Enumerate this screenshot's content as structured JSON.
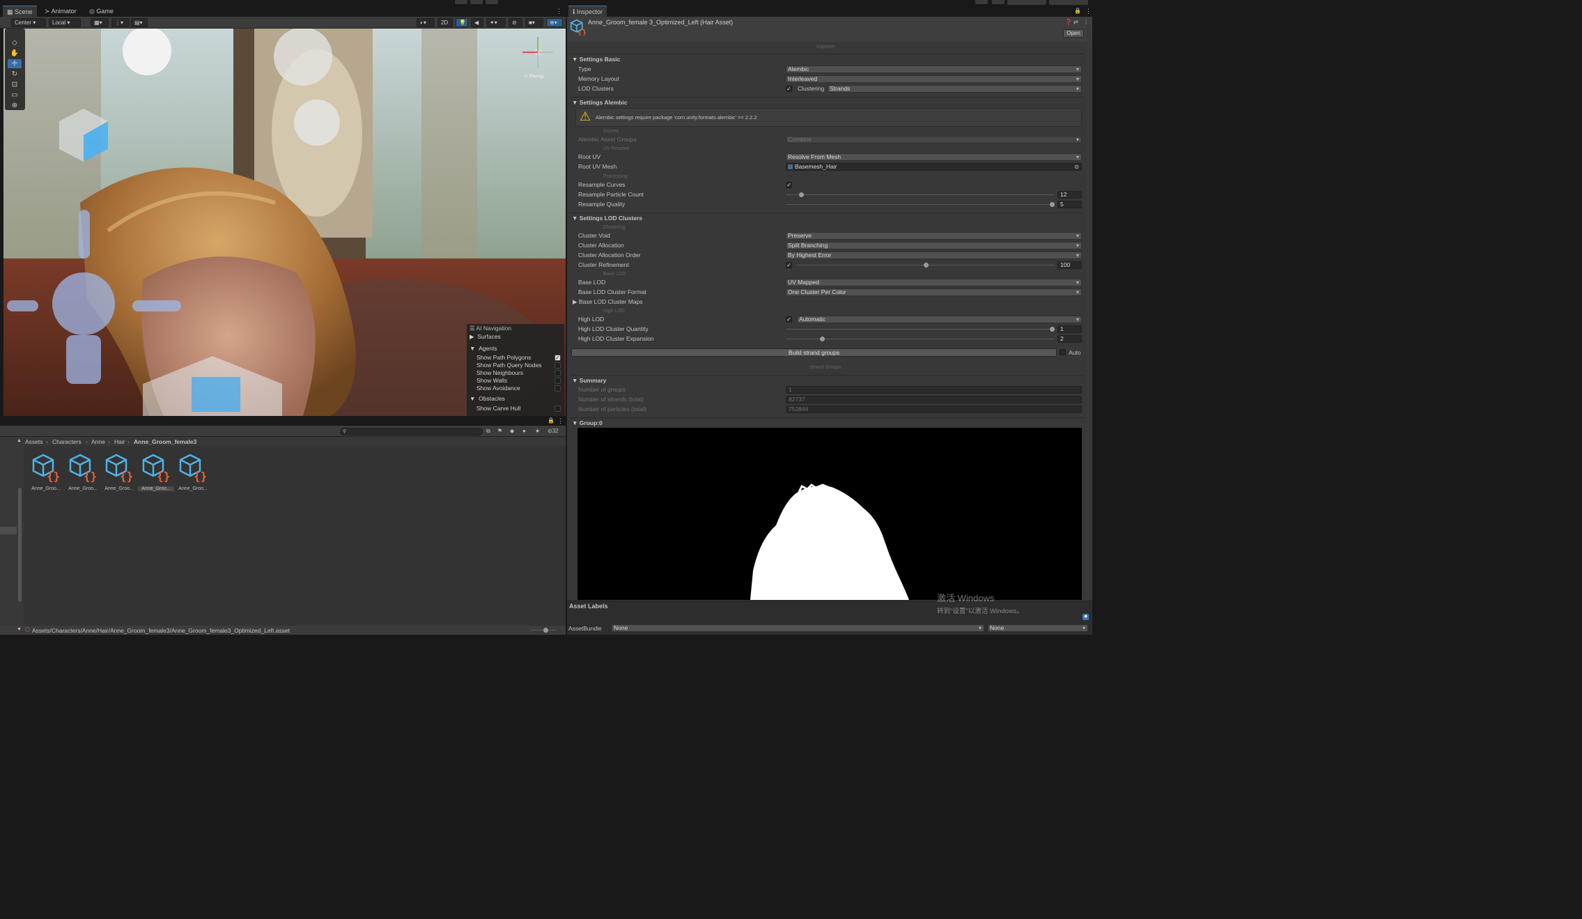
{
  "scene_tabs": {
    "scene": "Scene",
    "animator": "Animator",
    "game": "Game"
  },
  "scene_toolbar": {
    "pivot": "Center",
    "space": "Local",
    "mode_2d": "2D"
  },
  "viewport": {
    "persp_label": "< Persp"
  },
  "ai_navigation": {
    "title": "AI Navigation",
    "surfaces": "Surfaces",
    "agents": "Agents",
    "items": [
      {
        "label": "Show Path Polygons",
        "checked": true
      },
      {
        "label": "Show Path Query Nodes",
        "checked": false
      },
      {
        "label": "Show Neighbours",
        "checked": false
      },
      {
        "label": "Show Walls",
        "checked": false
      },
      {
        "label": "Show Avoidance",
        "checked": false
      }
    ],
    "obstacles": "Obstacles",
    "carve_hull": "Show Carve Hull"
  },
  "project": {
    "hidden_count": "32",
    "breadcrumb": [
      "Assets",
      "Characters",
      "Anne",
      "Hair",
      "Anne_Groom_female3"
    ],
    "assets": [
      {
        "label": "Anne_Groo...",
        "selected": false
      },
      {
        "label": "Anne_Groo...",
        "selected": false
      },
      {
        "label": "Anne_Groo...",
        "selected": false
      },
      {
        "label": "Anne_Groo...",
        "selected": true
      },
      {
        "label": "Anne_Groo...",
        "selected": false
      }
    ],
    "path": "Assets/Characters/Anne/Hair/Anne_Groom_female3/Anne_Groom_female3_Optimized_Left.asset"
  },
  "inspector": {
    "tab": "Inspector",
    "asset_title": "Anne_Groom_female 3_Optimized_Left (Hair Asset)",
    "open_button": "Open",
    "importer": "Importer",
    "settings_basic": {
      "header": "Settings Basic",
      "type_label": "Type",
      "type_value": "Alembic",
      "memory_label": "Memory Layout",
      "memory_value": "Interleaved",
      "lod_label": "LOD Clusters",
      "clustering_label": "Clustering",
      "clustering_value": "Strands"
    },
    "settings_alembic": {
      "header": "Settings Alembic",
      "warning": "Alembic settings require package 'com.unity.formats.alembic' >= 2.2.2",
      "curves_caption": "Curves",
      "asset_groups_label": "Alembic Asset Groups",
      "asset_groups_value": "Combine",
      "uv_caption": "UV Resolve",
      "root_uv_label": "Root UV",
      "root_uv_value": "Resolve From Mesh",
      "root_uv_mesh_label": "Root UV Mesh",
      "root_uv_mesh_value": "Basemesh_Hair",
      "processing_caption": "Processing",
      "resample_curves_label": "Resample Curves",
      "particle_count_label": "Resample Particle Count",
      "particle_count_value": "12",
      "particle_count_level": 0.05,
      "quality_label": "Resample Quality",
      "quality_value": "5",
      "quality_level": 1.0
    },
    "settings_lod": {
      "header": "Settings LOD Clusters",
      "clustering_caption": "Clustering",
      "void_label": "Cluster Void",
      "void_value": "Preserve",
      "allocation_label": "Cluster Allocation",
      "allocation_value": "Split Branching",
      "order_label": "Cluster Allocation Order",
      "order_value": "By Highest Error",
      "refinement_label": "Cluster Refinement",
      "refinement_value": "100",
      "refinement_level": 0.5,
      "base_caption": "Base LOD",
      "base_label": "Base LOD",
      "base_value": "UV Mapped",
      "format_label": "Base LOD Cluster Format",
      "format_value": "One Cluster Per Color",
      "maps_label": "Base LOD Cluster Maps",
      "high_caption": "High LOD",
      "high_label": "High LOD",
      "high_value": "Automatic",
      "quantity_label": "High LOD Cluster Quantity",
      "quantity_value": "1",
      "quantity_level": 1.0,
      "expansion_label": "High LOD Cluster Expansion",
      "expansion_value": "2",
      "expansion_level": 0.13,
      "build_button": "Build strand groups",
      "auto_label": "Auto"
    },
    "strand_groups_caption": "Strand Groups",
    "summary": {
      "header": "Summary",
      "groups_label": "Number of groups",
      "groups_value": "1",
      "strands_label": "Number of strands (total)",
      "strands_value": "82737",
      "particles_label": "Number of particles (total)",
      "particles_value": "752844"
    },
    "group_header": "Group:0",
    "asset_labels": "Asset Labels",
    "assetbundle_label": "AssetBundle",
    "assetbundle_value": "None",
    "variant_value": "None"
  },
  "watermark": {
    "line1": "激活 Windows",
    "line2": "转到\"设置\"以激活 Windows。"
  },
  "colors": {
    "accent": "#3a79bb",
    "asset_icon_blue": "#4fb3e8",
    "asset_icon_orange": "#e8643c",
    "warning": "#f5c518"
  }
}
